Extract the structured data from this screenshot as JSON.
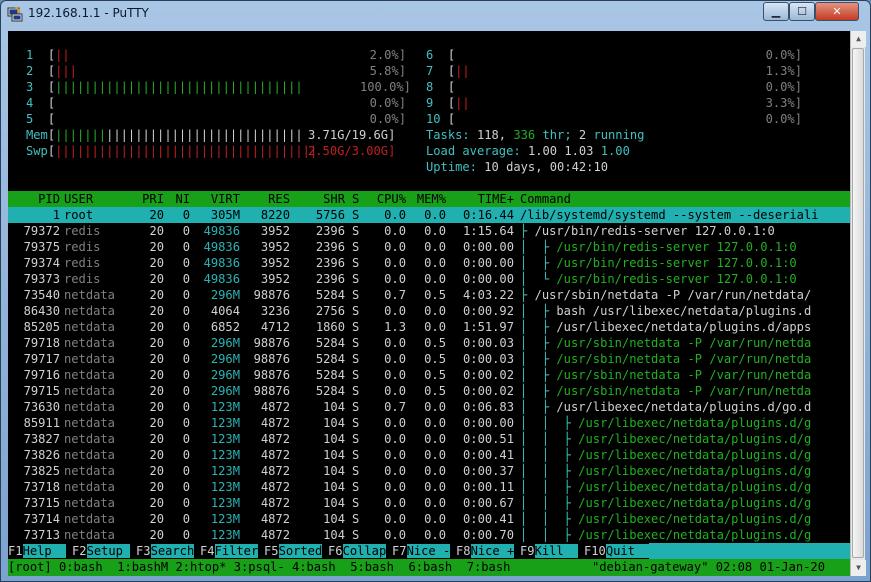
{
  "window": {
    "title": "192.168.1.1 - PuTTY"
  },
  "cpus": [
    {
      "id": "1",
      "bar": "||",
      "pct": "2.0%]"
    },
    {
      "id": "2",
      "bar": "|||",
      "pct": "5.8%]"
    },
    {
      "id": "3",
      "bar": "||||||||||||||||||||||||||||||||||",
      "pct": "100.0%]"
    },
    {
      "id": "4",
      "bar": "",
      "pct": "0.0%]"
    },
    {
      "id": "5",
      "bar": "",
      "pct": "0.0%]"
    },
    {
      "id": "6",
      "bar": "",
      "pct": "0.0%]"
    },
    {
      "id": "7",
      "bar": "||",
      "pct": "1.3%]"
    },
    {
      "id": "8",
      "bar": "",
      "pct": "0.0%]"
    },
    {
      "id": "9",
      "bar": "||",
      "pct": "3.3%]"
    },
    {
      "id": "10",
      "bar": "",
      "pct": "0.0%]"
    }
  ],
  "mem": {
    "label": "Mem",
    "value": "3.71G/19.6G]"
  },
  "swp": {
    "label": "Swp",
    "value": "2.50G/3.00G]"
  },
  "tasks": {
    "label": "Tasks:",
    "count": "118,",
    "thr": "336",
    "thr_label": "thr;",
    "running": "2",
    "running_label": "running"
  },
  "load": {
    "label": "Load average:",
    "v1": "1.00",
    "v2": "1.03",
    "v3": "1.00"
  },
  "uptime": {
    "label": "Uptime:",
    "value": "10 days, 00:42:10"
  },
  "columns": [
    "PID",
    "USER",
    "PRI",
    "NI",
    "VIRT",
    "RES",
    "SHR",
    "S",
    "CPU%",
    "MEM%",
    "TIME+",
    "Command"
  ],
  "processes": [
    {
      "pid": "1",
      "user": "root",
      "pri": "20",
      "ni": "0",
      "virt": "305M",
      "res": "8220",
      "shr": "5756",
      "s": "S",
      "cpu": "0.0",
      "mem": "0.0",
      "time": "0:16.44",
      "tree": "",
      "cmd": "/lib/systemd/systemd --system --deseriali",
      "selected": true
    },
    {
      "pid": "79372",
      "user": "redis",
      "pri": "20",
      "ni": "0",
      "virt": "49836",
      "res": "3952",
      "shr": "2396",
      "s": "S",
      "cpu": "0.0",
      "mem": "0.0",
      "time": "1:15.64",
      "tree": "├ ",
      "cmd": "/usr/bin/redis-server 127.0.0.1:0"
    },
    {
      "pid": "79375",
      "user": "redis",
      "pri": "20",
      "ni": "0",
      "virt": "49836",
      "res": "3952",
      "shr": "2396",
      "s": "S",
      "cpu": "0.0",
      "mem": "0.0",
      "time": "0:00.00",
      "tree": "│  ├ ",
      "cmd": "/usr/bin/redis-server 127.0.0.1:0"
    },
    {
      "pid": "79374",
      "user": "redis",
      "pri": "20",
      "ni": "0",
      "virt": "49836",
      "res": "3952",
      "shr": "2396",
      "s": "S",
      "cpu": "0.0",
      "mem": "0.0",
      "time": "0:00.00",
      "tree": "│  ├ ",
      "cmd": "/usr/bin/redis-server 127.0.0.1:0"
    },
    {
      "pid": "79373",
      "user": "redis",
      "pri": "20",
      "ni": "0",
      "virt": "49836",
      "res": "3952",
      "shr": "2396",
      "s": "S",
      "cpu": "0.0",
      "mem": "0.0",
      "time": "0:00.00",
      "tree": "│  └ ",
      "cmd": "/usr/bin/redis-server 127.0.0.1:0"
    },
    {
      "pid": "73540",
      "user": "netdata",
      "pri": "20",
      "ni": "0",
      "virt": "296M",
      "res": "98876",
      "shr": "5284",
      "s": "S",
      "cpu": "0.7",
      "mem": "0.5",
      "time": "4:03.22",
      "tree": "├ ",
      "cmd": "/usr/sbin/netdata -P /var/run/netdata/"
    },
    {
      "pid": "86430",
      "user": "netdata",
      "pri": "20",
      "ni": "0",
      "virt": "4064",
      "res": "3236",
      "shr": "2756",
      "s": "S",
      "cpu": "0.0",
      "mem": "0.0",
      "time": "0:00.92",
      "tree": "│  ├ ",
      "cmd": "bash /usr/libexec/netdata/plugins.d"
    },
    {
      "pid": "85205",
      "user": "netdata",
      "pri": "20",
      "ni": "0",
      "virt": "6852",
      "res": "4712",
      "shr": "1860",
      "s": "S",
      "cpu": "1.3",
      "mem": "0.0",
      "time": "1:51.97",
      "tree": "│  ├ ",
      "cmd": "/usr/libexec/netdata/plugins.d/apps"
    },
    {
      "pid": "79718",
      "user": "netdata",
      "pri": "20",
      "ni": "0",
      "virt": "296M",
      "res": "98876",
      "shr": "5284",
      "s": "S",
      "cpu": "0.0",
      "mem": "0.5",
      "time": "0:00.03",
      "tree": "│  ├ ",
      "cmd": "/usr/sbin/netdata -P /var/run/netda"
    },
    {
      "pid": "79717",
      "user": "netdata",
      "pri": "20",
      "ni": "0",
      "virt": "296M",
      "res": "98876",
      "shr": "5284",
      "s": "S",
      "cpu": "0.0",
      "mem": "0.5",
      "time": "0:00.03",
      "tree": "│  ├ ",
      "cmd": "/usr/sbin/netdata -P /var/run/netda"
    },
    {
      "pid": "79716",
      "user": "netdata",
      "pri": "20",
      "ni": "0",
      "virt": "296M",
      "res": "98876",
      "shr": "5284",
      "s": "S",
      "cpu": "0.0",
      "mem": "0.5",
      "time": "0:00.02",
      "tree": "│  ├ ",
      "cmd": "/usr/sbin/netdata -P /var/run/netda"
    },
    {
      "pid": "79715",
      "user": "netdata",
      "pri": "20",
      "ni": "0",
      "virt": "296M",
      "res": "98876",
      "shr": "5284",
      "s": "S",
      "cpu": "0.0",
      "mem": "0.5",
      "time": "0:00.02",
      "tree": "│  ├ ",
      "cmd": "/usr/sbin/netdata -P /var/run/netda"
    },
    {
      "pid": "73630",
      "user": "netdata",
      "pri": "20",
      "ni": "0",
      "virt": "123M",
      "res": "4872",
      "shr": "104",
      "s": "S",
      "cpu": "0.7",
      "mem": "0.0",
      "time": "0:06.83",
      "tree": "│  ├ ",
      "cmd": "/usr/libexec/netdata/plugins.d/go.d"
    },
    {
      "pid": "85911",
      "user": "netdata",
      "pri": "20",
      "ni": "0",
      "virt": "123M",
      "res": "4872",
      "shr": "104",
      "s": "S",
      "cpu": "0.0",
      "mem": "0.0",
      "time": "0:00.00",
      "tree": "│  │  ├ ",
      "cmd": "/usr/libexec/netdata/plugins.d/g"
    },
    {
      "pid": "73827",
      "user": "netdata",
      "pri": "20",
      "ni": "0",
      "virt": "123M",
      "res": "4872",
      "shr": "104",
      "s": "S",
      "cpu": "0.0",
      "mem": "0.0",
      "time": "0:00.51",
      "tree": "│  │  ├ ",
      "cmd": "/usr/libexec/netdata/plugins.d/g"
    },
    {
      "pid": "73826",
      "user": "netdata",
      "pri": "20",
      "ni": "0",
      "virt": "123M",
      "res": "4872",
      "shr": "104",
      "s": "S",
      "cpu": "0.0",
      "mem": "0.0",
      "time": "0:00.41",
      "tree": "│  │  ├ ",
      "cmd": "/usr/libexec/netdata/plugins.d/g"
    },
    {
      "pid": "73825",
      "user": "netdata",
      "pri": "20",
      "ni": "0",
      "virt": "123M",
      "res": "4872",
      "shr": "104",
      "s": "S",
      "cpu": "0.0",
      "mem": "0.0",
      "time": "0:00.37",
      "tree": "│  │  ├ ",
      "cmd": "/usr/libexec/netdata/plugins.d/g"
    },
    {
      "pid": "73718",
      "user": "netdata",
      "pri": "20",
      "ni": "0",
      "virt": "123M",
      "res": "4872",
      "shr": "104",
      "s": "S",
      "cpu": "0.0",
      "mem": "0.0",
      "time": "0:00.11",
      "tree": "│  │  ├ ",
      "cmd": "/usr/libexec/netdata/plugins.d/g"
    },
    {
      "pid": "73715",
      "user": "netdata",
      "pri": "20",
      "ni": "0",
      "virt": "123M",
      "res": "4872",
      "shr": "104",
      "s": "S",
      "cpu": "0.0",
      "mem": "0.0",
      "time": "0:00.67",
      "tree": "│  │  ├ ",
      "cmd": "/usr/libexec/netdata/plugins.d/g"
    },
    {
      "pid": "73714",
      "user": "netdata",
      "pri": "20",
      "ni": "0",
      "virt": "123M",
      "res": "4872",
      "shr": "104",
      "s": "S",
      "cpu": "0.0",
      "mem": "0.0",
      "time": "0:00.41",
      "tree": "│  │  ├ ",
      "cmd": "/usr/libexec/netdata/plugins.d/g"
    },
    {
      "pid": "73713",
      "user": "netdata",
      "pri": "20",
      "ni": "0",
      "virt": "123M",
      "res": "4872",
      "shr": "104",
      "s": "S",
      "cpu": "0.0",
      "mem": "0.0",
      "time": "0:00.70",
      "tree": "│  │  ├ ",
      "cmd": "/usr/libexec/netdata/plugins.d/g"
    }
  ],
  "fkeys": [
    {
      "key": "F1",
      "label": "Help  "
    },
    {
      "key": "F2",
      "label": "Setup "
    },
    {
      "key": "F3",
      "label": "Search"
    },
    {
      "key": "F4",
      "label": "Filter"
    },
    {
      "key": "F5",
      "label": "Sorted"
    },
    {
      "key": "F6",
      "label": "Collap"
    },
    {
      "key": "F7",
      "label": "Nice -"
    },
    {
      "key": "F8",
      "label": "Nice +"
    },
    {
      "key": "F9",
      "label": "Kill  "
    },
    {
      "key": "F10",
      "label": "Quit  "
    }
  ],
  "tmux": {
    "session": "[root]",
    "windows": "0:bash  1:bashM 2:htop* 3:psql- 4:bash  5:bash  6:bash  7:bash",
    "right": "\"debian-gateway\" 02:08 01-Jan-20"
  }
}
